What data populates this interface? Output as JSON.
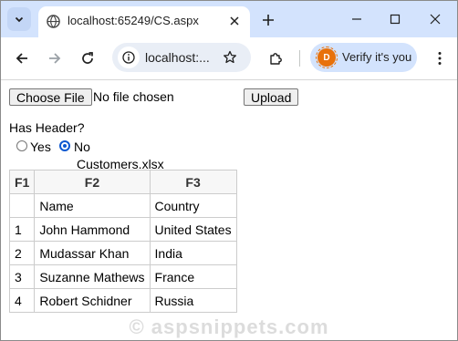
{
  "browser": {
    "tab_title": "localhost:65249/CS.aspx",
    "url": "localhost:...",
    "verify_label": "Verify it's you",
    "avatar_letter": "D",
    "accent": "#d3e3fd"
  },
  "form": {
    "choose_file_label": "Choose File",
    "file_status": "No file chosen",
    "upload_label": "Upload",
    "has_header_label": "Has Header?",
    "radio_yes": "Yes",
    "radio_no": "No",
    "selected_option": "No",
    "file_name": "Customers.xlsx"
  },
  "table": {
    "headers": [
      "F1",
      "F2",
      "F3"
    ],
    "rows": [
      [
        "",
        "Name",
        "Country"
      ],
      [
        "1",
        "John Hammond",
        "United States"
      ],
      [
        "2",
        "Mudassar Khan",
        "India"
      ],
      [
        "3",
        "Suzanne Mathews",
        "France"
      ],
      [
        "4",
        "Robert Schidner",
        "Russia"
      ]
    ]
  },
  "watermark": "© aspsnippets.com"
}
